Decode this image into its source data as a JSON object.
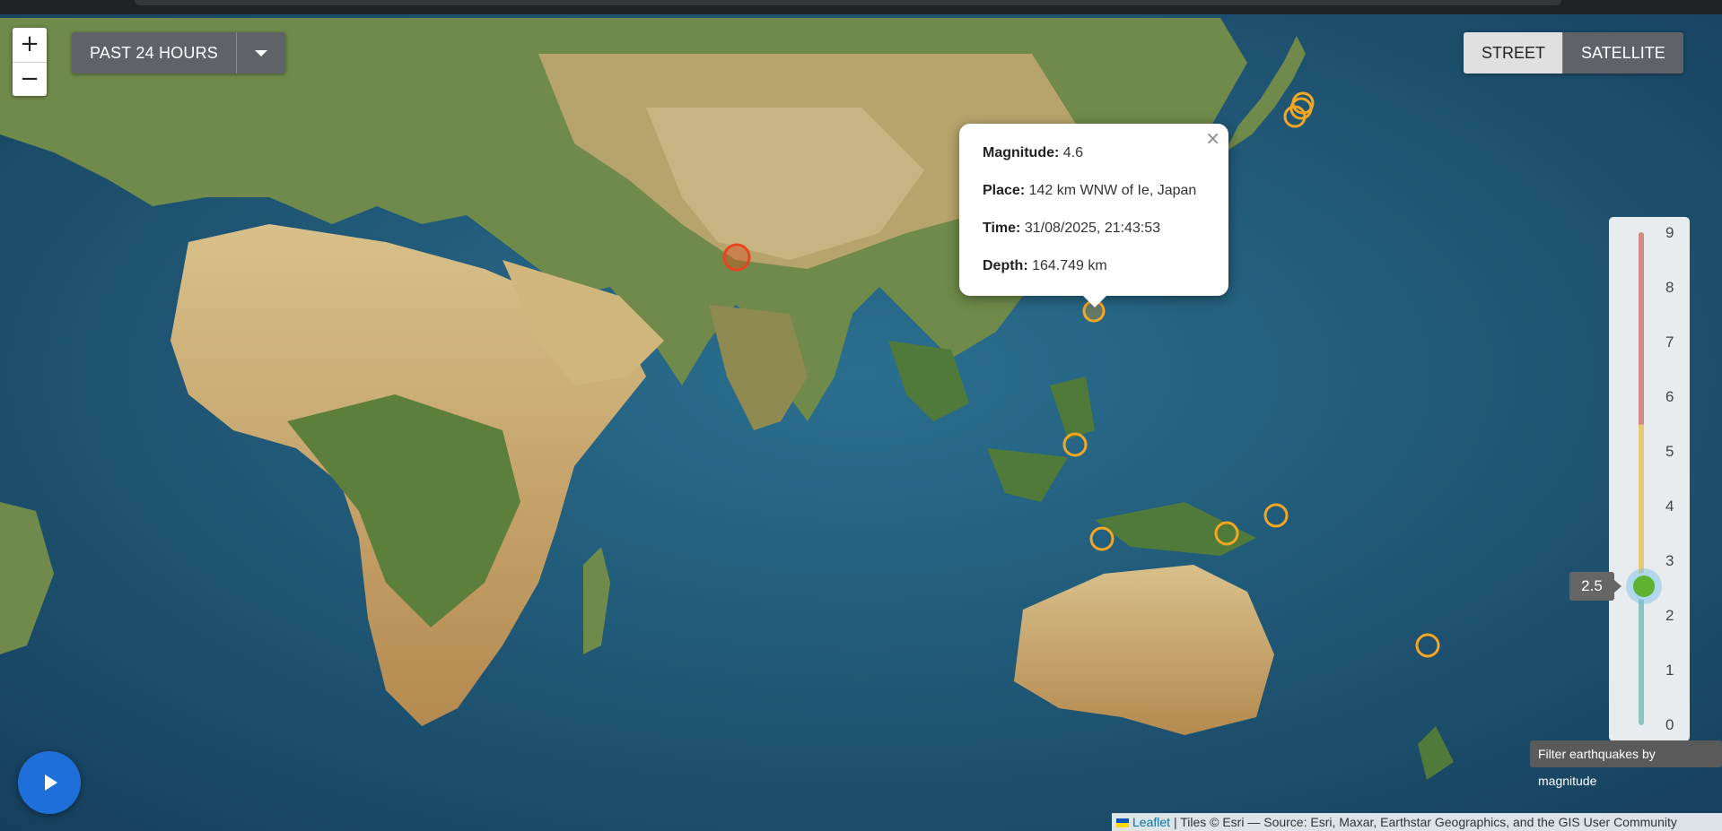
{
  "zoom": {
    "in_label": "+",
    "out_label": "−"
  },
  "time_range": {
    "label": "PAST 24 HOURS",
    "dropdown_icon": "caret-down-icon"
  },
  "base_layers": {
    "street": "STREET",
    "satellite": "SATELLITE",
    "active": "STREET"
  },
  "popup": {
    "magnitude_label": "Magnitude:",
    "magnitude": "4.6",
    "place_label": "Place:",
    "place": "142 km WNW of Ie, Japan",
    "time_label": "Time:",
    "time": "31/08/2025, 21:43:53",
    "depth_label": "Depth:",
    "depth": "164.749 km",
    "close_icon": "×"
  },
  "magnitude_slider": {
    "ticks": [
      "9",
      "8",
      "7",
      "6",
      "5",
      "4",
      "3",
      "2",
      "1",
      "0"
    ],
    "value": "2.5",
    "tooltip": "Filter earthquakes by magnitude"
  },
  "play_button": {
    "icon": "play-icon"
  },
  "attribution": {
    "leaflet": "Leaflet",
    "text": "| Tiles © Esri — Source: Esri, Maxar, Earthstar Geographics, and the GIS User Community"
  },
  "colors": {
    "marker": "#f5a623",
    "highlight_marker": "#e8451e",
    "accent": "#1e6fd9"
  }
}
